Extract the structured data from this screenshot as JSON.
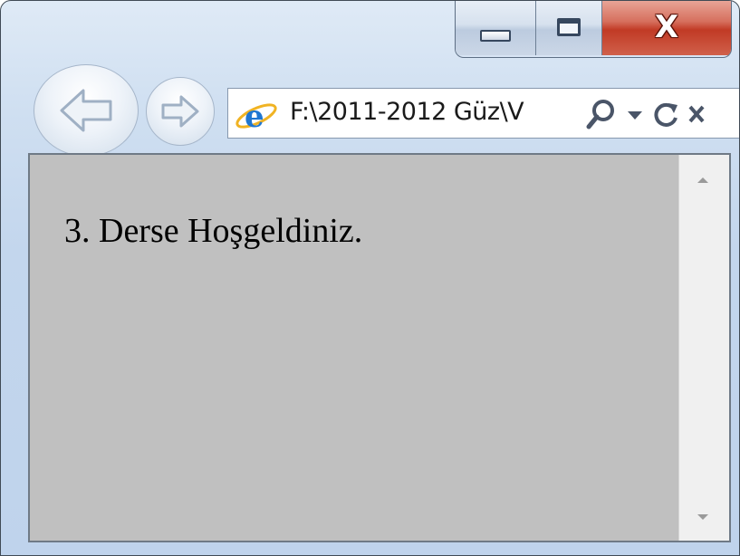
{
  "browser": {
    "address_text": "F:\\2011-2012 Güz\\V",
    "icons": {
      "back": "back-arrow-icon",
      "forward": "forward-arrow-icon",
      "page": "internet-explorer-icon",
      "search": "search-icon",
      "dropdown": "dropdown-arrow-icon",
      "refresh": "refresh-icon",
      "stop": "stop-icon"
    }
  },
  "window_controls": {
    "minimize": "minimize-icon",
    "maximize": "maximize-icon",
    "close": "close-icon",
    "close_glyph": "X"
  },
  "page": {
    "text": "3. Derse Hoşgeldiniz.",
    "background": "#c0c0c0"
  },
  "colors": {
    "close_red": "#c13a25",
    "frame_blue": "#c3d6ed"
  }
}
